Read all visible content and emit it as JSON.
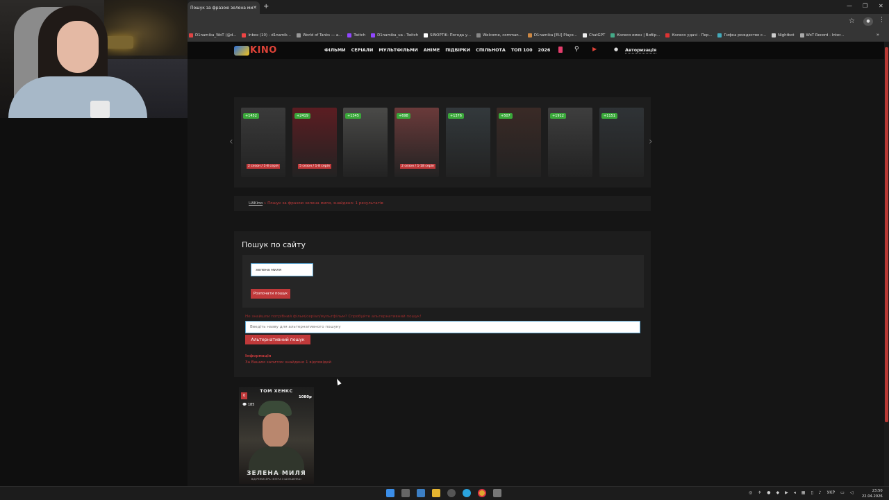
{
  "browser": {
    "tab_title": "Пошук за фразою зелена миля",
    "new_tab": "+",
    "bookmarks": [
      {
        "label": "D1namika_WoT (@d...",
        "color": "#d44"
      },
      {
        "label": "Inbox (10) - d1namik...",
        "color": "#e44"
      },
      {
        "label": "World of Tanks — a...",
        "color": "#999"
      },
      {
        "label": "Twitch",
        "color": "#9146ff"
      },
      {
        "label": "D1namika_ua - Twitch",
        "color": "#9146ff"
      },
      {
        "label": "SINOPTIK: Погода у...",
        "color": "#fff"
      },
      {
        "label": "Welcome, comman...",
        "color": "#888"
      },
      {
        "label": "D1namika [EU] Playe...",
        "color": "#c84"
      },
      {
        "label": "ChatGPT",
        "color": "#eee"
      },
      {
        "label": "Колесо имен | Вибір...",
        "color": "#4a8"
      },
      {
        "label": "Колесо удачі - Пер...",
        "color": "#d33"
      },
      {
        "label": "Гифка рождество с...",
        "color": "#4ab"
      },
      {
        "label": "Nightbot",
        "color": "#ccc"
      },
      {
        "label": "WoT Record - Inter...",
        "color": "#aaa"
      }
    ],
    "more": "»"
  },
  "site": {
    "logo": "KINO",
    "nav": [
      "ФІЛЬМИ",
      "СЕРІАЛИ",
      "МУЛЬТФІЛЬМИ",
      "АНІМЕ",
      "ПІДБІРКИ",
      "СПІЛЬНОТА",
      "ТОП 100",
      "2026"
    ],
    "login": "Авторизація"
  },
  "slider": {
    "items": [
      {
        "count": "+1452",
        "episodes": "2 сезон / 1-8 серія",
        "color": "#3a3a3a"
      },
      {
        "count": "+2419",
        "episodes": "5 сезон / 1-8 серія",
        "color": "#5b1d22"
      },
      {
        "count": "+1345",
        "episodes": "",
        "color": "#4a4a48"
      },
      {
        "count": "+698",
        "episodes": "2 сезон / 1-18 серія",
        "color": "#6a3a3a"
      },
      {
        "count": "+1376",
        "episodes": "",
        "color": "#33393c"
      },
      {
        "count": "+507",
        "episodes": "",
        "color": "#3a2a26"
      },
      {
        "count": "+1912",
        "episodes": "",
        "color": "#3e3e3e"
      },
      {
        "count": "+1151",
        "episodes": "",
        "color": "#2f3336"
      }
    ]
  },
  "breadcrumb": {
    "home": "UAKino",
    "rest": " » Пошук за фразою зелена миля, знайдено: 1 результатів"
  },
  "search": {
    "heading": "Пошук по сайту",
    "query_value": "зелена миля",
    "start_button": "Розпочати пошук",
    "alt_hint": "Не знайшли потрібний фільм/серіал/мультфільм? Спробуйте альтернативний пошук!",
    "alt_placeholder": "Введіть назву для альтернативного пошуку",
    "alt_button": "Альтернативний пошук",
    "info_heading": "Інформація",
    "info_text": "За Вашим запитом знайдено 1 відповідей"
  },
  "result": {
    "actor": "ТОМ ХЕНКС",
    "quality": "1080p",
    "badge": "0",
    "comments": "185",
    "title": "ЗЕЛЕНА МИЛЯ",
    "subtitle": "ВІД РЕЖИСЕРА «ВТЕЧА З ШОУШЕНКА»"
  },
  "taskbar": {
    "lang": "УКР",
    "time": "23:50",
    "date": "22.04.2026"
  },
  "colors": {
    "accent": "#c0393a",
    "count_badge": "#3aa83a"
  }
}
